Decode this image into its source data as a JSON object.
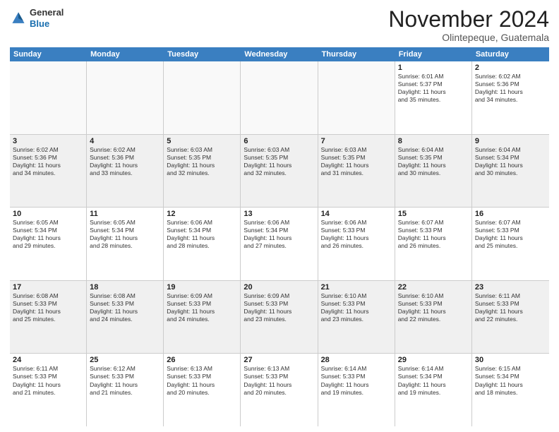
{
  "header": {
    "logo_general": "General",
    "logo_blue": "Blue",
    "month_title": "November 2024",
    "location": "Olintepeque, Guatemala"
  },
  "calendar": {
    "days_of_week": [
      "Sunday",
      "Monday",
      "Tuesday",
      "Wednesday",
      "Thursday",
      "Friday",
      "Saturday"
    ],
    "rows": [
      [
        {
          "day": "",
          "info": "",
          "empty": true
        },
        {
          "day": "",
          "info": "",
          "empty": true
        },
        {
          "day": "",
          "info": "",
          "empty": true
        },
        {
          "day": "",
          "info": "",
          "empty": true
        },
        {
          "day": "",
          "info": "",
          "empty": true
        },
        {
          "day": "1",
          "info": "Sunrise: 6:01 AM\nSunset: 5:37 PM\nDaylight: 11 hours\nand 35 minutes.",
          "empty": false
        },
        {
          "day": "2",
          "info": "Sunrise: 6:02 AM\nSunset: 5:36 PM\nDaylight: 11 hours\nand 34 minutes.",
          "empty": false
        }
      ],
      [
        {
          "day": "3",
          "info": "Sunrise: 6:02 AM\nSunset: 5:36 PM\nDaylight: 11 hours\nand 34 minutes.",
          "empty": false
        },
        {
          "day": "4",
          "info": "Sunrise: 6:02 AM\nSunset: 5:36 PM\nDaylight: 11 hours\nand 33 minutes.",
          "empty": false
        },
        {
          "day": "5",
          "info": "Sunrise: 6:03 AM\nSunset: 5:35 PM\nDaylight: 11 hours\nand 32 minutes.",
          "empty": false
        },
        {
          "day": "6",
          "info": "Sunrise: 6:03 AM\nSunset: 5:35 PM\nDaylight: 11 hours\nand 32 minutes.",
          "empty": false
        },
        {
          "day": "7",
          "info": "Sunrise: 6:03 AM\nSunset: 5:35 PM\nDaylight: 11 hours\nand 31 minutes.",
          "empty": false
        },
        {
          "day": "8",
          "info": "Sunrise: 6:04 AM\nSunset: 5:35 PM\nDaylight: 11 hours\nand 30 minutes.",
          "empty": false
        },
        {
          "day": "9",
          "info": "Sunrise: 6:04 AM\nSunset: 5:34 PM\nDaylight: 11 hours\nand 30 minutes.",
          "empty": false
        }
      ],
      [
        {
          "day": "10",
          "info": "Sunrise: 6:05 AM\nSunset: 5:34 PM\nDaylight: 11 hours\nand 29 minutes.",
          "empty": false
        },
        {
          "day": "11",
          "info": "Sunrise: 6:05 AM\nSunset: 5:34 PM\nDaylight: 11 hours\nand 28 minutes.",
          "empty": false
        },
        {
          "day": "12",
          "info": "Sunrise: 6:06 AM\nSunset: 5:34 PM\nDaylight: 11 hours\nand 28 minutes.",
          "empty": false
        },
        {
          "day": "13",
          "info": "Sunrise: 6:06 AM\nSunset: 5:34 PM\nDaylight: 11 hours\nand 27 minutes.",
          "empty": false
        },
        {
          "day": "14",
          "info": "Sunrise: 6:06 AM\nSunset: 5:33 PM\nDaylight: 11 hours\nand 26 minutes.",
          "empty": false
        },
        {
          "day": "15",
          "info": "Sunrise: 6:07 AM\nSunset: 5:33 PM\nDaylight: 11 hours\nand 26 minutes.",
          "empty": false
        },
        {
          "day": "16",
          "info": "Sunrise: 6:07 AM\nSunset: 5:33 PM\nDaylight: 11 hours\nand 25 minutes.",
          "empty": false
        }
      ],
      [
        {
          "day": "17",
          "info": "Sunrise: 6:08 AM\nSunset: 5:33 PM\nDaylight: 11 hours\nand 25 minutes.",
          "empty": false
        },
        {
          "day": "18",
          "info": "Sunrise: 6:08 AM\nSunset: 5:33 PM\nDaylight: 11 hours\nand 24 minutes.",
          "empty": false
        },
        {
          "day": "19",
          "info": "Sunrise: 6:09 AM\nSunset: 5:33 PM\nDaylight: 11 hours\nand 24 minutes.",
          "empty": false
        },
        {
          "day": "20",
          "info": "Sunrise: 6:09 AM\nSunset: 5:33 PM\nDaylight: 11 hours\nand 23 minutes.",
          "empty": false
        },
        {
          "day": "21",
          "info": "Sunrise: 6:10 AM\nSunset: 5:33 PM\nDaylight: 11 hours\nand 23 minutes.",
          "empty": false
        },
        {
          "day": "22",
          "info": "Sunrise: 6:10 AM\nSunset: 5:33 PM\nDaylight: 11 hours\nand 22 minutes.",
          "empty": false
        },
        {
          "day": "23",
          "info": "Sunrise: 6:11 AM\nSunset: 5:33 PM\nDaylight: 11 hours\nand 22 minutes.",
          "empty": false
        }
      ],
      [
        {
          "day": "24",
          "info": "Sunrise: 6:11 AM\nSunset: 5:33 PM\nDaylight: 11 hours\nand 21 minutes.",
          "empty": false
        },
        {
          "day": "25",
          "info": "Sunrise: 6:12 AM\nSunset: 5:33 PM\nDaylight: 11 hours\nand 21 minutes.",
          "empty": false
        },
        {
          "day": "26",
          "info": "Sunrise: 6:13 AM\nSunset: 5:33 PM\nDaylight: 11 hours\nand 20 minutes.",
          "empty": false
        },
        {
          "day": "27",
          "info": "Sunrise: 6:13 AM\nSunset: 5:33 PM\nDaylight: 11 hours\nand 20 minutes.",
          "empty": false
        },
        {
          "day": "28",
          "info": "Sunrise: 6:14 AM\nSunset: 5:33 PM\nDaylight: 11 hours\nand 19 minutes.",
          "empty": false
        },
        {
          "day": "29",
          "info": "Sunrise: 6:14 AM\nSunset: 5:34 PM\nDaylight: 11 hours\nand 19 minutes.",
          "empty": false
        },
        {
          "day": "30",
          "info": "Sunrise: 6:15 AM\nSunset: 5:34 PM\nDaylight: 11 hours\nand 18 minutes.",
          "empty": false
        }
      ]
    ]
  }
}
